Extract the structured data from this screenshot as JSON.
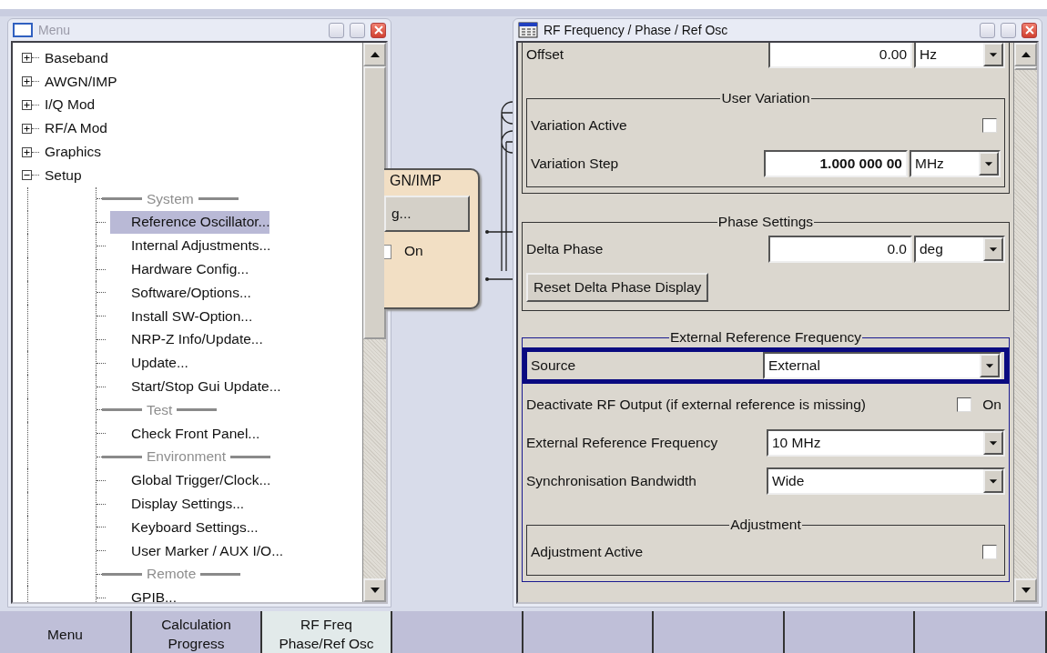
{
  "menu_window": {
    "title": "Menu",
    "tree": [
      {
        "label": "Baseband",
        "expanded": false
      },
      {
        "label": "AWGN/IMP",
        "expanded": false
      },
      {
        "label": "I/Q Mod",
        "expanded": false
      },
      {
        "label": "RF/A Mod",
        "expanded": false
      },
      {
        "label": "Graphics",
        "expanded": false
      },
      {
        "label": "Setup",
        "expanded": true,
        "children": [
          {
            "kind": "heading",
            "label": "System"
          },
          {
            "kind": "item",
            "label": "Reference Oscillator...",
            "selected": true
          },
          {
            "kind": "item",
            "label": "Internal Adjustments...",
            "selected": false
          },
          {
            "kind": "item",
            "label": "Hardware Config...",
            "selected": false
          },
          {
            "kind": "item",
            "label": "Software/Options...",
            "selected": false
          },
          {
            "kind": "item",
            "label": "Install SW-Option...",
            "selected": false
          },
          {
            "kind": "item",
            "label": "NRP-Z Info/Update...",
            "selected": false
          },
          {
            "kind": "item",
            "label": "Update...",
            "selected": false
          },
          {
            "kind": "item",
            "label": "Start/Stop Gui Update...",
            "selected": false
          },
          {
            "kind": "heading",
            "label": "Test"
          },
          {
            "kind": "item",
            "label": "Check Front Panel...",
            "selected": false
          },
          {
            "kind": "heading",
            "label": "Environment"
          },
          {
            "kind": "item",
            "label": "Global Trigger/Clock...",
            "selected": false
          },
          {
            "kind": "item",
            "label": "Display Settings...",
            "selected": false
          },
          {
            "kind": "item",
            "label": "Keyboard Settings...",
            "selected": false
          },
          {
            "kind": "item",
            "label": "User Marker / AUX I/O...",
            "selected": false
          },
          {
            "kind": "heading",
            "label": "Remote"
          },
          {
            "kind": "item",
            "label": "GPIB...",
            "selected": false
          }
        ]
      }
    ]
  },
  "block_diagram": {
    "block_title": "GN/IMP",
    "button": "g...",
    "checkbox": {
      "label": "On",
      "checked": false
    }
  },
  "rf_window": {
    "title": "RF Frequency / Phase / Ref Osc",
    "groups": [
      {
        "rows": [
          {
            "kind": "number",
            "label": "Offset",
            "value": "0.00",
            "unit": "Hz"
          }
        ],
        "groups": [
          {
            "title": "User Variation",
            "rows": [
              {
                "kind": "checkbox",
                "label": "Variation Active",
                "checked": false
              },
              {
                "kind": "number",
                "label": "Variation Step",
                "value": "1.000 000 00",
                "unit": "MHz",
                "bold": true
              }
            ]
          }
        ]
      },
      {
        "title": "Phase Settings",
        "rows": [
          {
            "kind": "number",
            "label": "Delta Phase",
            "value": "0.0",
            "unit": "deg"
          },
          {
            "kind": "button",
            "label": "Reset Delta Phase Display"
          }
        ]
      },
      {
        "title": "External Reference Frequency",
        "highlighted": true,
        "rows": [
          {
            "kind": "select",
            "label": "Source",
            "value": "External",
            "focused": true
          },
          {
            "kind": "checkbox",
            "label": "Deactivate RF Output (if external reference is missing)",
            "checked": false,
            "option": "On"
          },
          {
            "kind": "select",
            "label": "External Reference Frequency",
            "value": "10 MHz",
            "focused": false
          },
          {
            "kind": "select",
            "label": "Synchronisation Bandwidth",
            "value": "Wide",
            "focused": false
          }
        ],
        "groups": [
          {
            "title": "Adjustment",
            "rows": [
              {
                "kind": "checkbox",
                "label": "Adjustment Active",
                "checked": false
              }
            ]
          }
        ]
      }
    ]
  },
  "taskbar": [
    {
      "label": "Menu",
      "selected": false
    },
    {
      "label": "Calculation Progress",
      "selected": false
    },
    {
      "label": "RF Freq Phase/Ref Osc",
      "selected": true
    },
    {
      "selected": false
    },
    {
      "selected": false
    },
    {
      "selected": false
    },
    {
      "selected": false
    },
    {
      "selected": false
    }
  ]
}
